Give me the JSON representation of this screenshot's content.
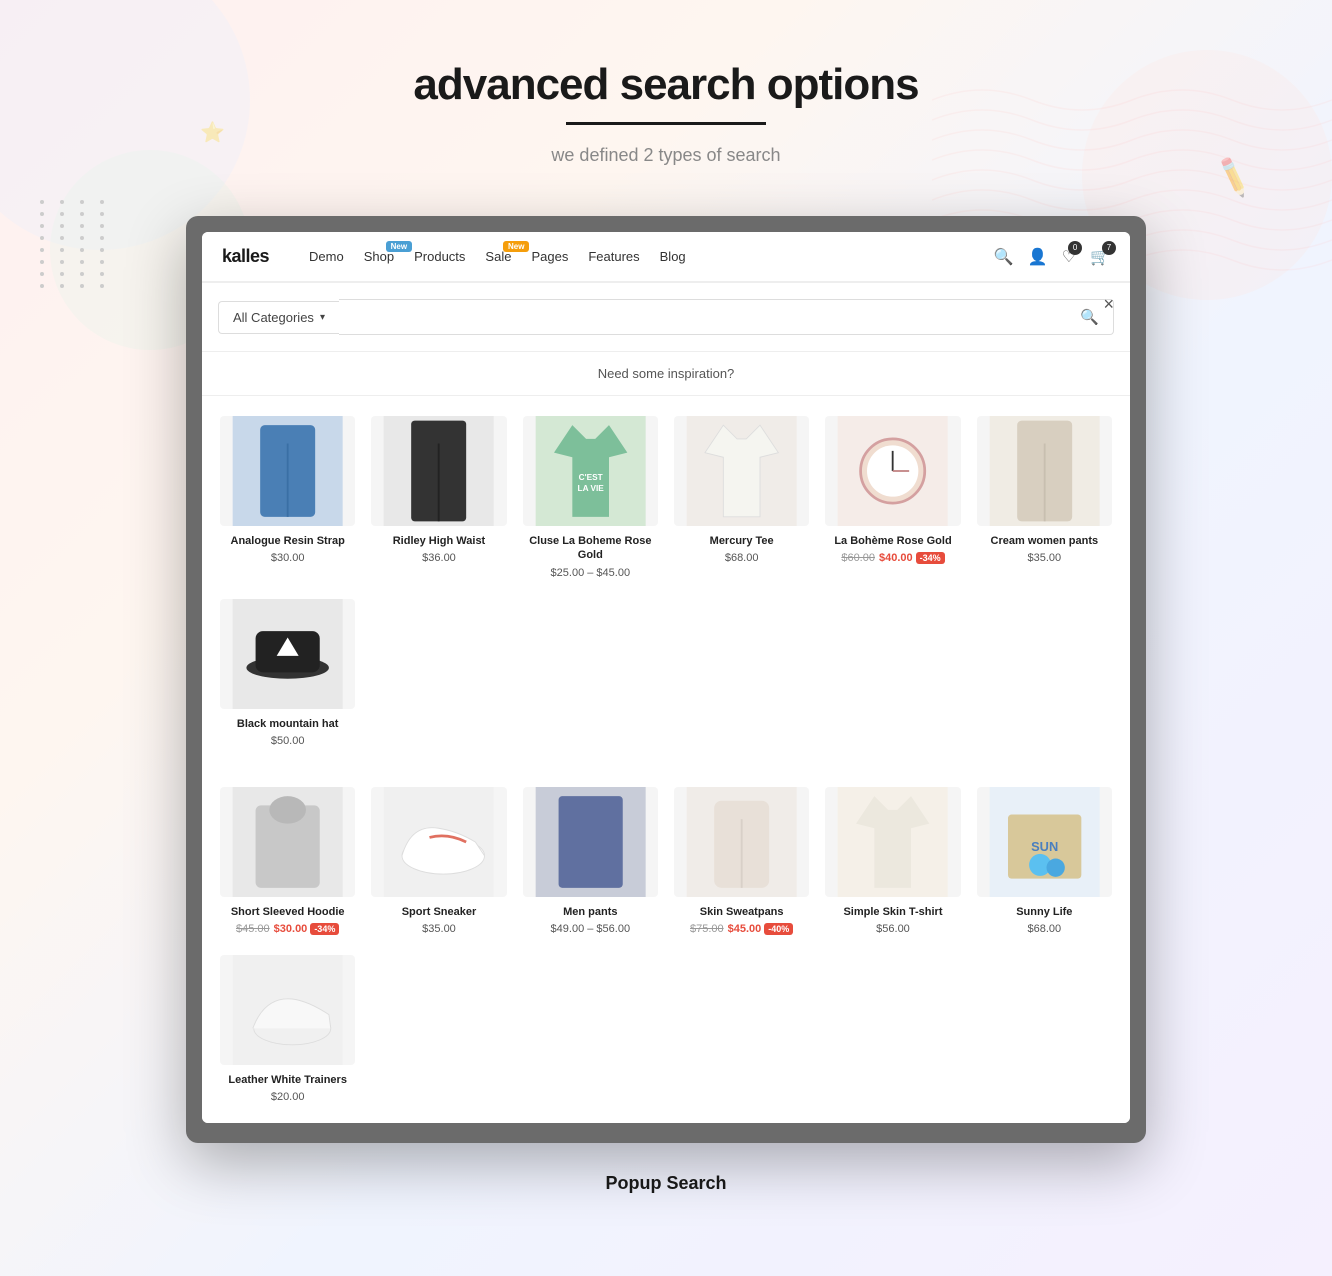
{
  "page": {
    "title": "advanced search  options",
    "underline": true,
    "subtitle": "we defined 2 types of search"
  },
  "navbar": {
    "logo": "kalles",
    "nav_items": [
      {
        "label": "Demo",
        "badge": null
      },
      {
        "label": "Shop",
        "badge": "New"
      },
      {
        "label": "Products",
        "badge": null
      },
      {
        "label": "Sale",
        "badge": "New"
      },
      {
        "label": "Pages",
        "badge": null
      },
      {
        "label": "Features",
        "badge": null
      },
      {
        "label": "Blog",
        "badge": null
      }
    ],
    "icons": [
      {
        "name": "search",
        "symbol": "🔍",
        "badge": null
      },
      {
        "name": "user",
        "symbol": "👤",
        "badge": null
      },
      {
        "name": "wishlist",
        "symbol": "♡",
        "badge": "0"
      },
      {
        "name": "cart",
        "symbol": "🛒",
        "badge": "7"
      }
    ]
  },
  "search_modal": {
    "close_label": "×",
    "category_select_label": "All Categories",
    "search_placeholder": "",
    "inspiration_text": "Need some inspiration?"
  },
  "products_row1": [
    {
      "name": "Analogue Resin Strap",
      "price": "$30.00",
      "original_price": null,
      "badge": null,
      "color": "#c8d8ea",
      "type": "pants_blue"
    },
    {
      "name": "Ridley High Waist",
      "price": "$36.00",
      "original_price": null,
      "badge": null,
      "color": "#e8e8e8",
      "type": "pants_black"
    },
    {
      "name": "Cluse La Boheme Rose Gold",
      "price": "$25.00 – $45.00",
      "original_price": null,
      "badge": null,
      "color": "#d4e8d4",
      "type": "tshirt_green"
    },
    {
      "name": "Mercury Tee",
      "price": "$68.00",
      "original_price": null,
      "badge": null,
      "color": "#f0ece8",
      "type": "tshirt_white"
    },
    {
      "name": "La Bohème Rose Gold",
      "price": "$40.00",
      "original_price": "$60.00",
      "badge": "-34%",
      "color": "#f5ece8",
      "type": "watch"
    },
    {
      "name": "Cream women pants",
      "price": "$35.00",
      "original_price": null,
      "badge": null,
      "color": "#f0ece4",
      "type": "pants_cream"
    },
    {
      "name": "Black mountain hat",
      "price": "$50.00",
      "original_price": null,
      "badge": null,
      "color": "#e8e8e8",
      "type": "hat"
    }
  ],
  "products_row2": [
    {
      "name": "Short Sleeved Hoodie",
      "price": "$30.00",
      "original_price": "$45.00",
      "badge": "-34%",
      "color": "#e8e8e8",
      "type": "hoodie"
    },
    {
      "name": "Sport Sneaker",
      "price": "$35.00",
      "original_price": null,
      "badge": null,
      "color": "#f0f0f0",
      "type": "sneaker"
    },
    {
      "name": "Men pants",
      "price": "$49.00 – $56.00",
      "original_price": null,
      "badge": null,
      "color": "#c8ccd8",
      "type": "jeans"
    },
    {
      "name": "Skin Sweatpans",
      "price": "$45.00",
      "original_price": "$75.00",
      "badge": "-40%",
      "color": "#f0ece8",
      "type": "sweatpants"
    },
    {
      "name": "Simple Skin T-shirt",
      "price": "$56.00",
      "original_price": null,
      "badge": null,
      "color": "#f5f0e8",
      "type": "tshirt_cream"
    },
    {
      "name": "Sunny Life",
      "price": "$68.00",
      "original_price": null,
      "badge": null,
      "color": "#e8f0f8",
      "type": "box"
    },
    {
      "name": "Leather White Trainers",
      "price": "$20.00",
      "original_price": null,
      "badge": null,
      "color": "#f0f0f0",
      "type": "trainers"
    }
  ],
  "footer": {
    "label": "Popup Search"
  },
  "colors": {
    "accent_blue": "#4a9fd4",
    "accent_orange": "#f59e0b",
    "sale_red": "#e74c3c",
    "dark": "#1a1a1a"
  }
}
